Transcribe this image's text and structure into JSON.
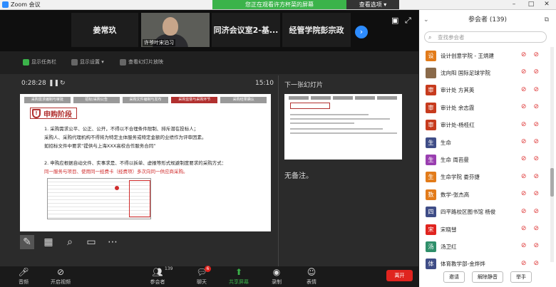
{
  "window": {
    "title": "Zoom 会议",
    "share_banner": "您正在观看许方杯菜的屏幕",
    "stop_share": "查看选项 ▾"
  },
  "video_strip": {
    "tiles": [
      {
        "label": "姜常玖"
      },
      {
        "label": "许爷叶宋泊习",
        "is_video": true
      },
      {
        "label": "同济会议室2-基..."
      },
      {
        "label": "经管学院彭宗政"
      }
    ]
  },
  "share_toolbar": {
    "items": [
      "显示任务栏",
      "显示设置 ▾",
      "查看幻灯片放映"
    ]
  },
  "presenter": {
    "elapsed": "0:28:28",
    "clock": "15:10",
    "next_slide_label": "下一张幻灯片",
    "notes": "无备注。"
  },
  "slide": {
    "steps": [
      "采购需求编制与审批",
      "招标/采购公告",
      "采购文件编制与发布",
      "采购监督与采购环节",
      "采购结果确认"
    ],
    "active_step": 3,
    "title": "申购阶段",
    "shield_glyph": "!",
    "lines": [
      {
        "text": "1. 采购需求公平、公正、公开，不得以不合理条件限制、排斥潜在投标人；"
      },
      {
        "text": "采购人、采购代理机构不得将为特定主体服务或特定金额的业绩作为评审因素。"
      },
      {
        "text": "如招标文件中要求“提供与上海XXX高校合作服务合同”"
      },
      {
        "text": "2. 申购应根据自动文件、实事求是、不得以拆单、虚报等形式规避制度要求的采购方式："
      },
      {
        "text": "同一服务与项目、使用同一经费卡（经费项）多次向同一供应商采购。"
      }
    ]
  },
  "slide_tools": [
    "pen-tool",
    "slides-grid",
    "zoom",
    "screen",
    "more"
  ],
  "bottom_bar": {
    "items": [
      {
        "label": "音频",
        "icon": "microphone-icon"
      },
      {
        "label": "开启视频",
        "icon": "video-off-icon"
      },
      {
        "label": "参会者",
        "icon": "participants-icon",
        "count": "139"
      },
      {
        "label": "聊天",
        "icon": "chat-icon",
        "badge": "6"
      },
      {
        "label": "共享屏幕",
        "icon": "share-screen-icon"
      },
      {
        "label": "录制",
        "icon": "record-icon"
      },
      {
        "label": "表情",
        "icon": "reactions-icon"
      }
    ],
    "end_label": "离开"
  },
  "participants": {
    "header": "参会者 (139)",
    "search_placeholder": "查找参会者",
    "people": [
      {
        "avatar": "设",
        "color": "#e27b1a",
        "name": "设计创意学院 - 王炳建"
      },
      {
        "avatar": "",
        "color": "#8a6a4a",
        "name": "沈向阳 国际足球学院"
      },
      {
        "avatar": "审",
        "color": "#c73b1e",
        "name": "审计处 方其英"
      },
      {
        "avatar": "审",
        "color": "#c73b1e",
        "name": "审计处 余志霞"
      },
      {
        "avatar": "审",
        "color": "#c73b1e",
        "name": "审计处-杨桂红"
      },
      {
        "avatar": "生",
        "color": "#3f4d87",
        "name": "生命"
      },
      {
        "avatar": "生",
        "color": "#9a3fb0",
        "name": "生命 周芭曼"
      },
      {
        "avatar": "生",
        "color": "#e27b1a",
        "name": "生命学院 娄芬捷"
      },
      {
        "avatar": "数",
        "color": "#e27b1a",
        "name": "数学-张杰高"
      },
      {
        "avatar": "四",
        "color": "#3f4d87",
        "name": "四平路校区图书馆 杨俊"
      },
      {
        "avatar": "宋",
        "color": "#e0241f",
        "name": "宋晓彗"
      },
      {
        "avatar": "汤",
        "color": "#2f8f6a",
        "name": "汤卫红"
      },
      {
        "avatar": "体",
        "color": "#3f4d87",
        "name": "体育教学部-金烨烨"
      }
    ],
    "footer": [
      "邀请",
      "解除静音",
      "举手"
    ]
  }
}
